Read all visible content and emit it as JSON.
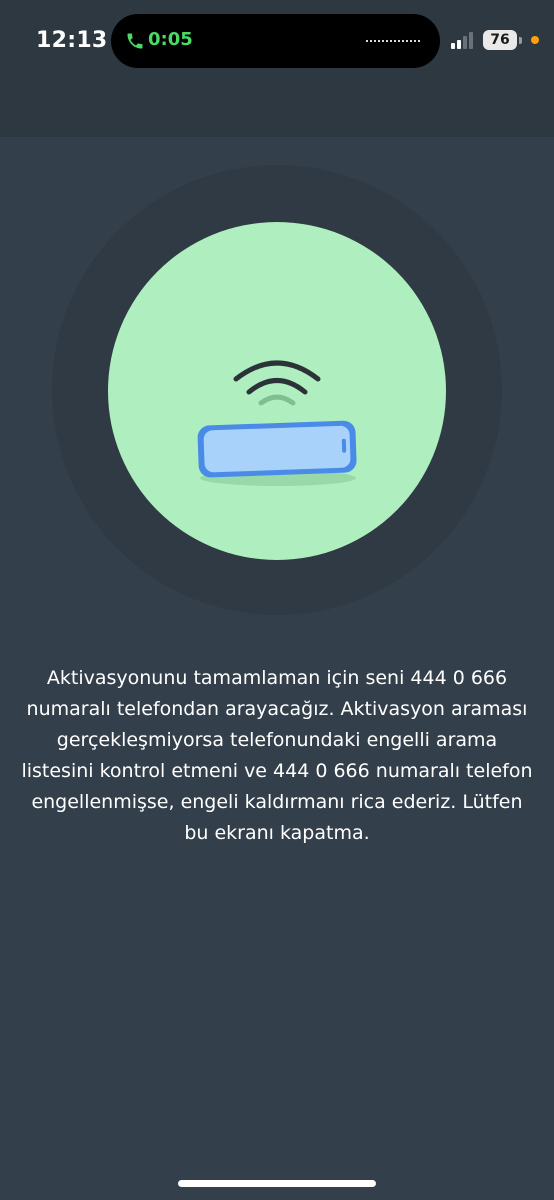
{
  "status_bar": {
    "time": "12:13",
    "call_timer": "0:05",
    "battery_level": "76",
    "colors": {
      "call_green": "#4cd964",
      "mic_indicator": "#ff9f0a"
    }
  },
  "illustration": {
    "icon": "phone-receiving-signal-icon",
    "colors": {
      "circle": "#aeeebf",
      "phone": "#7ab4f5"
    }
  },
  "main": {
    "message": "Aktivasyonunu tamamlaman için seni 444 0 666 numaralı telefondan arayacağız. Aktivasyon araması gerçekleşmiyorsa telefonundaki engelli arama listesini kontrol etmeni ve 444 0 666 numaralı telefon engellenmişse, engeli kaldırmanı rica ederiz. Lütfen bu ekranı kapatma."
  },
  "theme": {
    "background": "#333f4a",
    "header": "#2d3841"
  }
}
